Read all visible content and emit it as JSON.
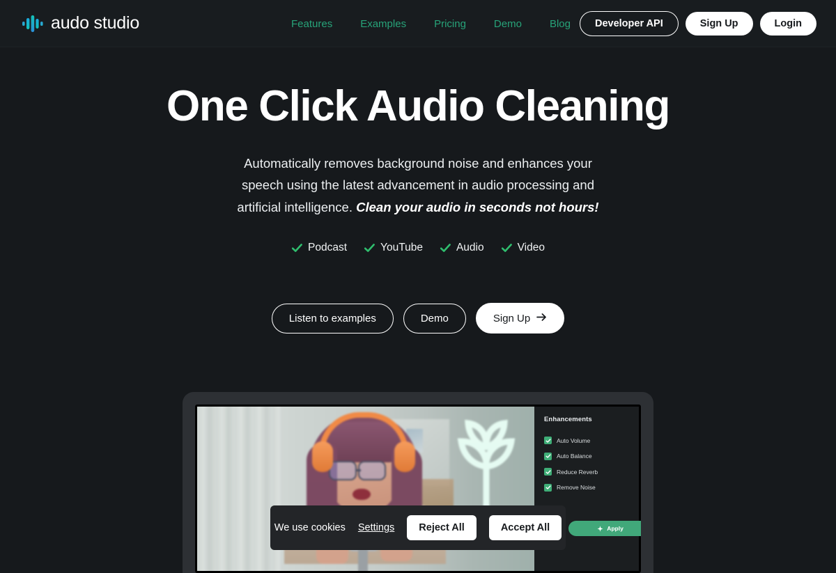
{
  "brand": {
    "name": "audo studio",
    "logo_icon": "audio-waveform-icon",
    "logo_colors": [
      "#2f9bd6",
      "#19b3cd",
      "#13c6b6",
      "#1fa8e0"
    ]
  },
  "nav": {
    "links": [
      {
        "label": "Features"
      },
      {
        "label": "Examples"
      },
      {
        "label": "Pricing"
      },
      {
        "label": "Demo"
      },
      {
        "label": "Blog"
      }
    ],
    "link_color": "#27a379",
    "actions": [
      {
        "label": "Developer API",
        "style": "outline"
      },
      {
        "label": "Sign Up",
        "style": "solid"
      },
      {
        "label": "Login",
        "style": "solid"
      }
    ]
  },
  "hero": {
    "title": "One Click Audio Cleaning",
    "subtitle_plain": "Automatically removes background noise and enhances your speech using the latest advancement in audio processing and artificial intelligence. ",
    "subtitle_accent": "Clean your audio in seconds not hours!",
    "features": [
      {
        "label": "Podcast",
        "icon": "check-icon"
      },
      {
        "label": "YouTube",
        "icon": "check-icon"
      },
      {
        "label": "Audio",
        "icon": "check-icon"
      },
      {
        "label": "Video",
        "icon": "check-icon"
      }
    ],
    "check_color": "#2fbe6e",
    "cta": [
      {
        "label": "Listen to examples",
        "style": "outline"
      },
      {
        "label": "Demo",
        "style": "outline"
      },
      {
        "label": "Sign Up",
        "style": "solid",
        "icon": "arrow-right-icon"
      }
    ]
  },
  "mockup": {
    "device": "laptop",
    "screenshot_subject": "podcaster with orange headphones speaking into microphone",
    "panel": {
      "title": "Enhancements",
      "options": [
        {
          "label": "Auto Volume",
          "checked": true
        },
        {
          "label": "Auto Balance",
          "checked": true
        },
        {
          "label": "Reduce Reverb",
          "checked": true
        },
        {
          "label": "Remove Noise",
          "checked": true
        }
      ],
      "apply_label": "Apply",
      "apply_icon": "sparkle-icon",
      "apply_color": "#41a87a"
    }
  },
  "cookie_banner": {
    "message": "We use cookies",
    "settings_label": "Settings",
    "reject_label": "Reject All",
    "accept_label": "Accept All"
  },
  "theme": {
    "background": "#16191c",
    "header_background": "#181c1f",
    "text": "#ffffff",
    "green_accent": "#27a379"
  }
}
